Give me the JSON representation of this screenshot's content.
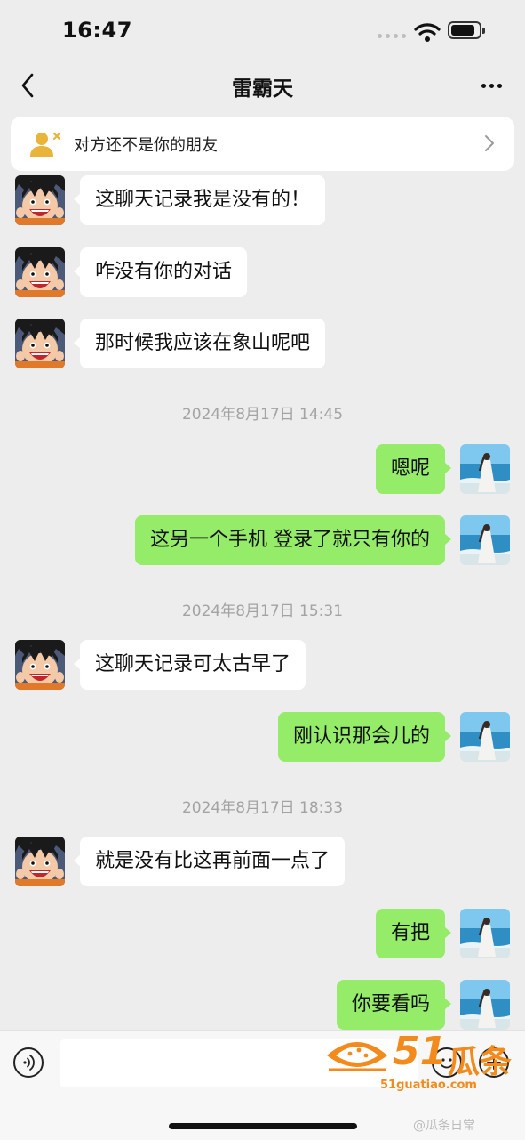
{
  "status_bar": {
    "time": "16:47",
    "battery_level": 0.85
  },
  "nav": {
    "title": "雷霸天"
  },
  "banner": {
    "text": "对方还不是你的朋友"
  },
  "messages": [
    {
      "side": "left",
      "text": "这聊天记录我是没有的！"
    },
    {
      "side": "left",
      "text": "咋没有你的对话"
    },
    {
      "side": "left",
      "text": "那时候我应该在象山呢吧"
    },
    {
      "type": "time",
      "text": "2024年8月17日 14:45"
    },
    {
      "side": "right",
      "text": "嗯呢"
    },
    {
      "side": "right",
      "text": "这另一个手机 登录了就只有你的"
    },
    {
      "type": "time",
      "text": "2024年8月17日 15:31"
    },
    {
      "side": "left",
      "text": "这聊天记录可太古早了"
    },
    {
      "side": "right",
      "text": "刚认识那会儿的"
    },
    {
      "type": "time",
      "text": "2024年8月17日 18:33"
    },
    {
      "side": "left",
      "text": "就是没有比这再前面一点了"
    },
    {
      "side": "right",
      "text": "有把"
    },
    {
      "side": "right",
      "text": "你要看吗"
    }
  ],
  "input": {
    "value": "",
    "placeholder": ""
  },
  "watermark": {
    "brand_number": "51",
    "brand_name": "瓜条",
    "url": "51guatiao.com",
    "credit": "@瓜条日常"
  },
  "icons": {
    "back": "chevron-left-icon",
    "more": "more-icon",
    "friend": "person-x-icon",
    "chevron": "chevron-right-icon",
    "voice": "voice-icon",
    "emoji": "emoji-icon",
    "plus": "plus-icon"
  },
  "colors": {
    "background": "#ededed",
    "outgoing_bubble": "#95ec69",
    "incoming_bubble": "#ffffff",
    "timestamp": "#a3a3a3",
    "friend_icon": "#e8b43a",
    "watermark": "#f28a1c"
  }
}
